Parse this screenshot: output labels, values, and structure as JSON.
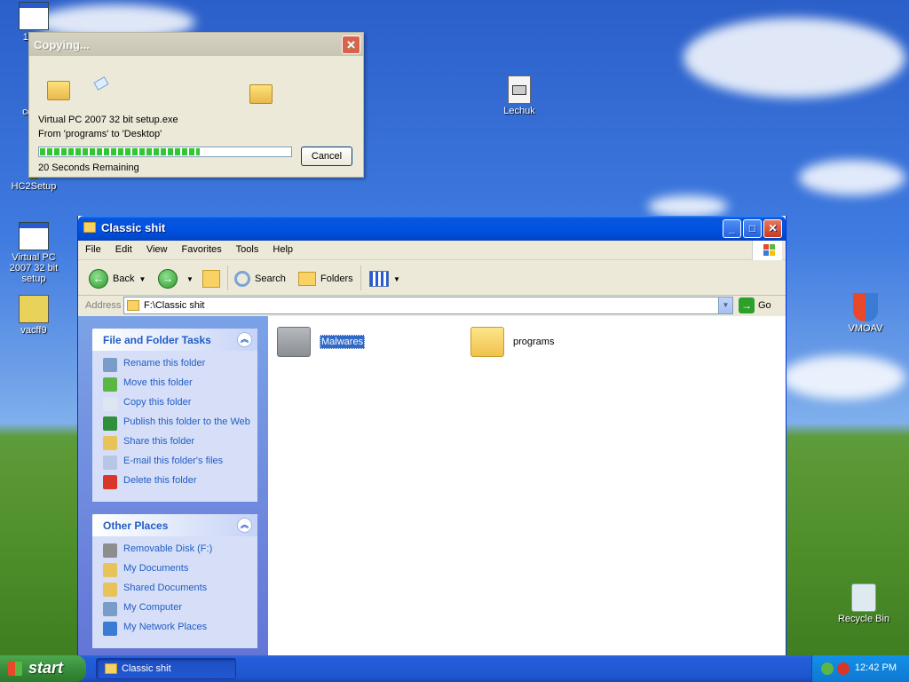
{
  "desktop": {
    "icons": [
      {
        "label": "1.0.1"
      },
      {
        "label": "ccset"
      },
      {
        "label": "HC2Setup"
      },
      {
        "label": "Virtual PC 2007 32 bit setup"
      },
      {
        "label": "vacff9"
      },
      {
        "label": "Lechuk"
      },
      {
        "label": "VMOAV"
      },
      {
        "label": "Recycle Bin"
      }
    ]
  },
  "copy_dialog": {
    "title": "Copying...",
    "filename": "Virtual PC 2007 32 bit setup.exe",
    "from_to": "From 'programs' to 'Desktop'",
    "progress": 0.64,
    "cancel_label": "Cancel",
    "remaining": "20 Seconds Remaining"
  },
  "explorer": {
    "title": "Classic shit",
    "menu": [
      "File",
      "Edit",
      "View",
      "Favorites",
      "Tools",
      "Help"
    ],
    "toolbar": {
      "back": "Back",
      "search": "Search",
      "folders": "Folders"
    },
    "address": {
      "label": "Address",
      "value": "F:\\Classic shit",
      "go": "Go"
    },
    "file_tasks": {
      "title": "File and Folder Tasks",
      "items": [
        {
          "label": "Rename this folder",
          "icon": "rename-icon"
        },
        {
          "label": "Move this folder",
          "icon": "move-icon"
        },
        {
          "label": "Copy this folder",
          "icon": "copy-icon"
        },
        {
          "label": "Publish this folder to the Web",
          "icon": "globe-icon"
        },
        {
          "label": "Share this folder",
          "icon": "share-icon"
        },
        {
          "label": "E-mail this folder's files",
          "icon": "email-icon"
        },
        {
          "label": "Delete this folder",
          "icon": "delete-icon"
        }
      ]
    },
    "other_places": {
      "title": "Other Places",
      "items": [
        {
          "label": "Removable Disk (F:)",
          "icon": "drive-icon"
        },
        {
          "label": "My Documents",
          "icon": "documents-icon"
        },
        {
          "label": "Shared Documents",
          "icon": "shared-folder-icon"
        },
        {
          "label": "My Computer",
          "icon": "computer-icon"
        },
        {
          "label": "My Network Places",
          "icon": "network-icon"
        }
      ]
    },
    "folders": [
      {
        "name": "Malwares",
        "selected": true
      },
      {
        "name": "programs",
        "selected": false
      }
    ]
  },
  "taskbar": {
    "start": "start",
    "task_button": "Classic shit",
    "clock": "12:42 PM"
  },
  "colors": {
    "xp_blue": "#0054e3",
    "task_link": "#215dc6",
    "selection": "#316ac5"
  }
}
